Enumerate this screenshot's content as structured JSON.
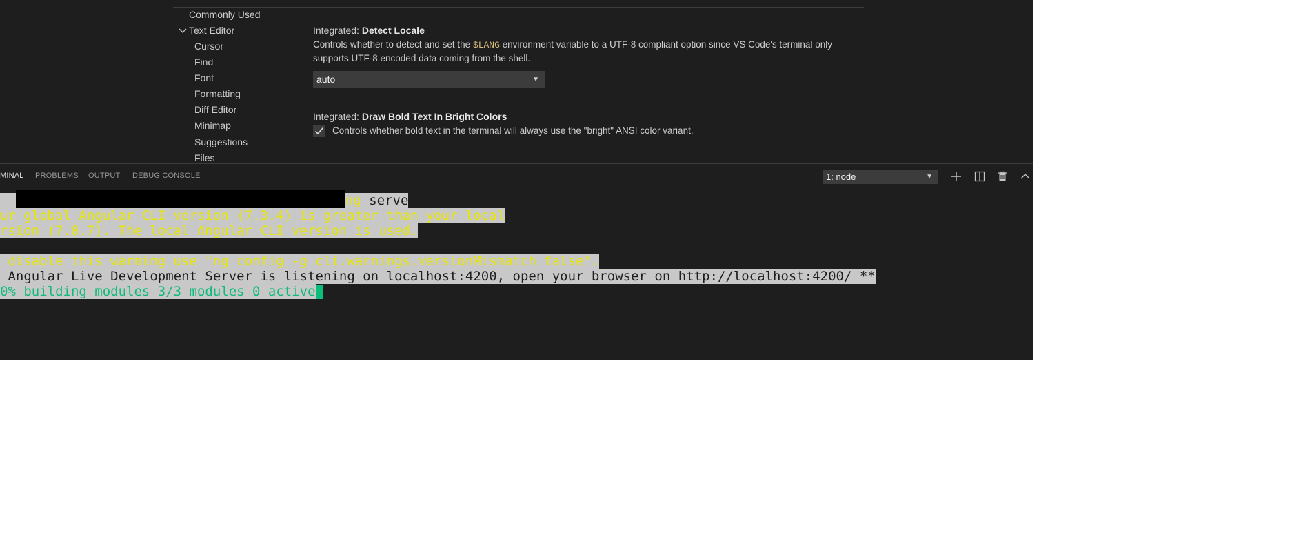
{
  "colors": {
    "editor_bg": "#1e1e1e",
    "terminal_yellow": "#e5e510",
    "terminal_green": "#0dbc79",
    "selection_bg": "#c8c8c8",
    "code_token": "#d7ba7d"
  },
  "sidebar": {
    "items": [
      {
        "label": "Commonly Used"
      },
      {
        "label": "Text Editor"
      },
      {
        "label": "Cursor"
      },
      {
        "label": "Find"
      },
      {
        "label": "Font"
      },
      {
        "label": "Formatting"
      },
      {
        "label": "Diff Editor"
      },
      {
        "label": "Minimap"
      },
      {
        "label": "Suggestions"
      },
      {
        "label": "Files"
      }
    ],
    "chevron_icon": "chevron-down-icon"
  },
  "settings": {
    "detect_locale": {
      "category": "Integrated: ",
      "name": "Detect Locale",
      "desc_before": "Controls whether to detect and set the ",
      "desc_token": "$LANG",
      "desc_after_1": " environment variable to a UTF-8 compliant option since VS Code's terminal only",
      "desc_after_2": "supports UTF-8 encoded data coming from the shell.",
      "value": "auto"
    },
    "bold_bright": {
      "category": "Integrated: ",
      "name": "Draw Bold Text In Bright Colors",
      "desc": "Controls whether bold text in the terminal will always use the \"bright\" ANSI color variant.",
      "checked": true
    }
  },
  "panel": {
    "tabs": [
      {
        "label": "MINAL",
        "active": true
      },
      {
        "label": "PROBLEMS",
        "active": false
      },
      {
        "label": "OUTPUT",
        "active": false
      },
      {
        "label": "DEBUG CONSOLE",
        "active": false
      }
    ],
    "terminal_select": "1: node",
    "actions": [
      "plus-icon",
      "split-icon",
      "trash-icon",
      "chevron-up-icon"
    ]
  },
  "terminal": {
    "line1_cmd_ng": "ng",
    "line1_cmd_serve": " serve",
    "line2": "ur global Angular CLI version (7.3.4) is greater than your local",
    "line3": "rsion (7.0.7). The local Angular CLI version is used.",
    "line4": " disable this warning use \"ng config -g cli.warnings.versionMismatch false\".",
    "line5": " Angular Live Development Server is listening on localhost:4200, open your browser on http://localhost:4200/ **",
    "line6": "0% building modules 3/3 modules 0 active"
  }
}
